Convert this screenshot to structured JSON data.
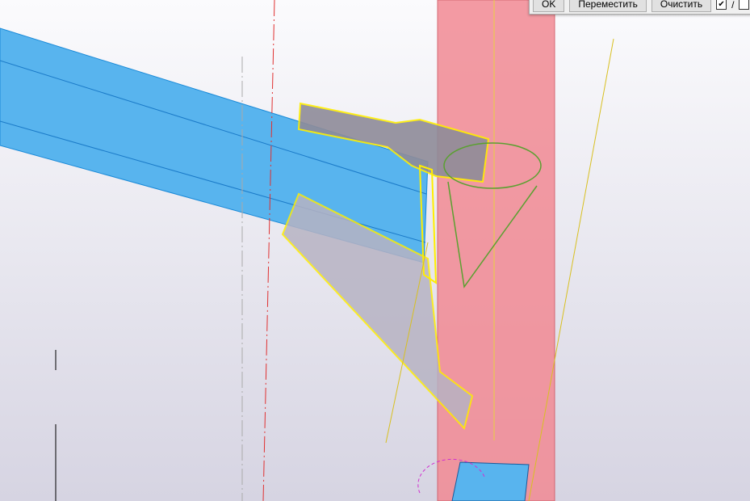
{
  "toolbar": {
    "ok_label": "OK",
    "move_label": "Переместить",
    "clear_label": "Очистить",
    "checkbox1_checked": true,
    "separator": "/",
    "checkbox2_checked": false,
    "check_mark": "✔"
  }
}
